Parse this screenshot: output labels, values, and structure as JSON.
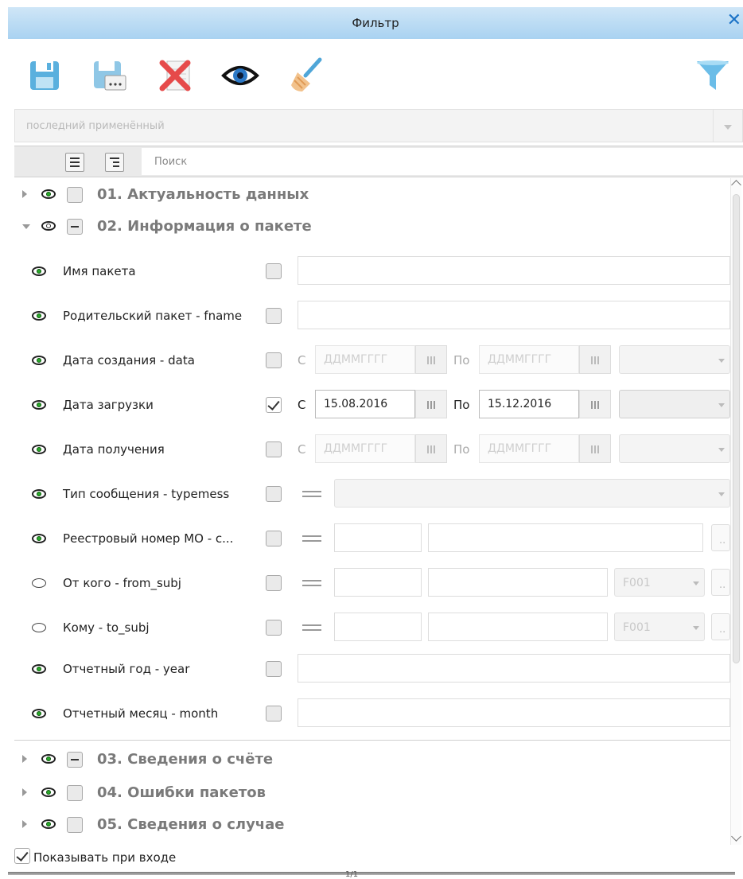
{
  "window": {
    "title": "Фильтр",
    "close_glyph": "✕"
  },
  "toolbar": {
    "icons": [
      "save-icon",
      "save-as-icon",
      "delete-icon",
      "preview-eye-icon",
      "clear-broom-icon",
      "filter-funnel-icon"
    ]
  },
  "preset": {
    "value": "последний применённый"
  },
  "search": {
    "placeholder": "Поиск"
  },
  "sections": [
    {
      "label": "01. Актуальность данных"
    },
    {
      "label": "02. Информация о пакете"
    },
    {
      "label": "03. Сведения о счёте"
    },
    {
      "label": "04. Ошибки пакетов"
    },
    {
      "label": "05. Сведения о случае"
    }
  ],
  "fields": {
    "package_name": {
      "label": "Имя пакета",
      "value": ""
    },
    "parent_package": {
      "label": "Родительский пакет - fname",
      "value": ""
    },
    "create_date": {
      "label": "Дата создания - data",
      "from": "С",
      "to": "По",
      "from_placeholder": "ДДММГГГГ",
      "to_placeholder": "ДДММГГГГ"
    },
    "load_date": {
      "label": "Дата загрузки",
      "from": "С",
      "to": "По",
      "from_value": "15.08.2016",
      "to_value": "15.12.2016",
      "checked": true
    },
    "receive_date": {
      "label": "Дата получения",
      "from": "С",
      "to": "По",
      "from_placeholder": "ДДММГГГГ",
      "to_placeholder": "ДДММГГГГ"
    },
    "message_type": {
      "label": "Тип сообщения - typemess"
    },
    "registry_number": {
      "label": "Реестровый номер МО - с...",
      "dots": ".."
    },
    "from_subj": {
      "label": "От кого - from_subj",
      "code": "F001",
      "dots": ".."
    },
    "to_subj": {
      "label": "Кому - to_subj",
      "code": "F001",
      "dots": ".."
    },
    "report_year": {
      "label": "Отчетный год - year"
    },
    "report_month": {
      "label": "Отчетный месяц - month"
    }
  },
  "footer": {
    "show_on_start": "Показывать при входе",
    "checked": true,
    "pages": "1/1"
  }
}
